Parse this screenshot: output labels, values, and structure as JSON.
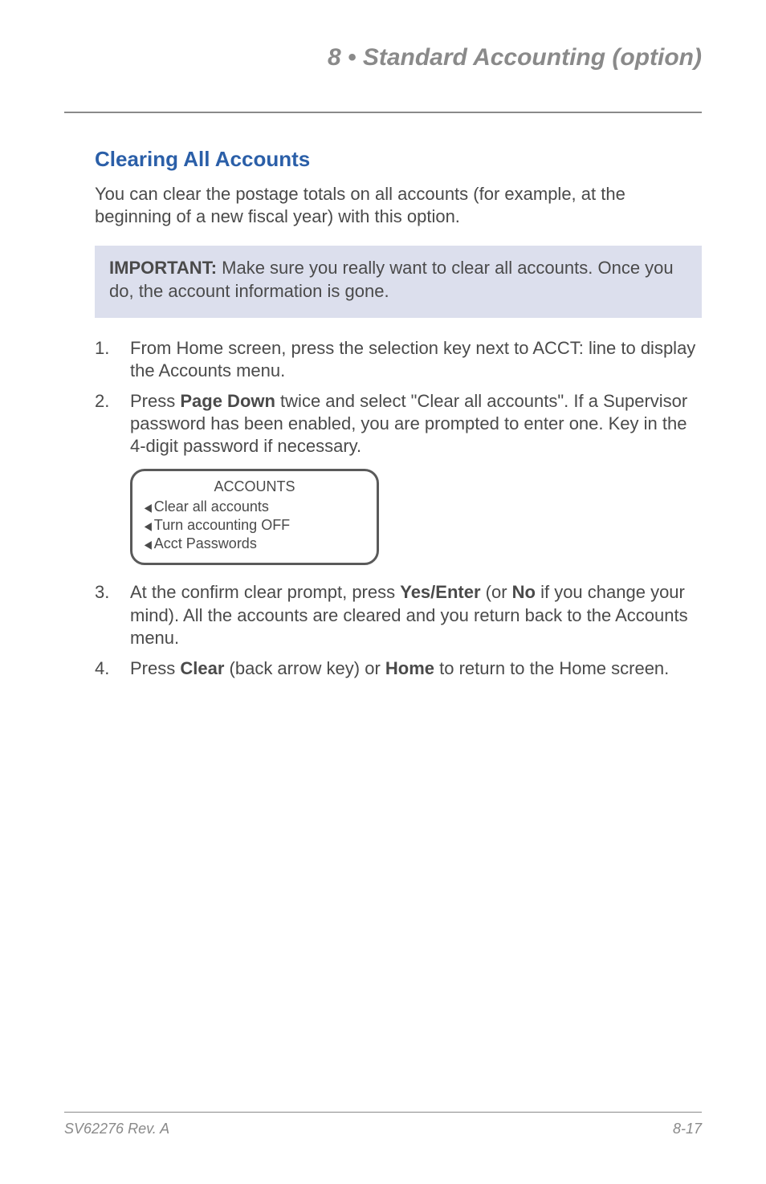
{
  "chapter": "8 • Standard Accounting (option)",
  "section_title": "Clearing All Accounts",
  "intro": "You can clear the postage totals on all accounts (for example, at the beginning of a new fiscal year) with this option.",
  "callout": {
    "label": "IMPORTANT:",
    "text": " Make sure you really want to clear all accounts. Once you do, the account information is gone."
  },
  "steps": [
    {
      "num": "1.",
      "text": "From Home screen, press the selection key next to ACCT: line to display the Accounts menu."
    },
    {
      "num": "2.",
      "prefix": "Press ",
      "bold1": "Page Down",
      "suffix": " twice and select \"Clear all accounts\". If a Supervisor password has been enabled, you are prompted to enter one. Key in the 4-digit password if necessary."
    },
    {
      "num": "3.",
      "prefix": "At the confirm clear prompt, press ",
      "bold1": "Yes/Enter",
      "mid": " (or ",
      "bold2": "No",
      "suffix": " if you change your mind). All the accounts are cleared and you return back to the Accounts menu."
    },
    {
      "num": "4.",
      "prefix": "Press ",
      "bold1": "Clear",
      "mid": " (back arrow key) or ",
      "bold2": "Home",
      "suffix": " to return to the Home screen."
    }
  ],
  "device_screen": {
    "title": "ACCOUNTS",
    "lines": [
      "Clear all accounts",
      "Turn accounting OFF",
      "Acct Passwords"
    ]
  },
  "footer": {
    "left": "SV62276 Rev. A",
    "right": "8-17"
  }
}
